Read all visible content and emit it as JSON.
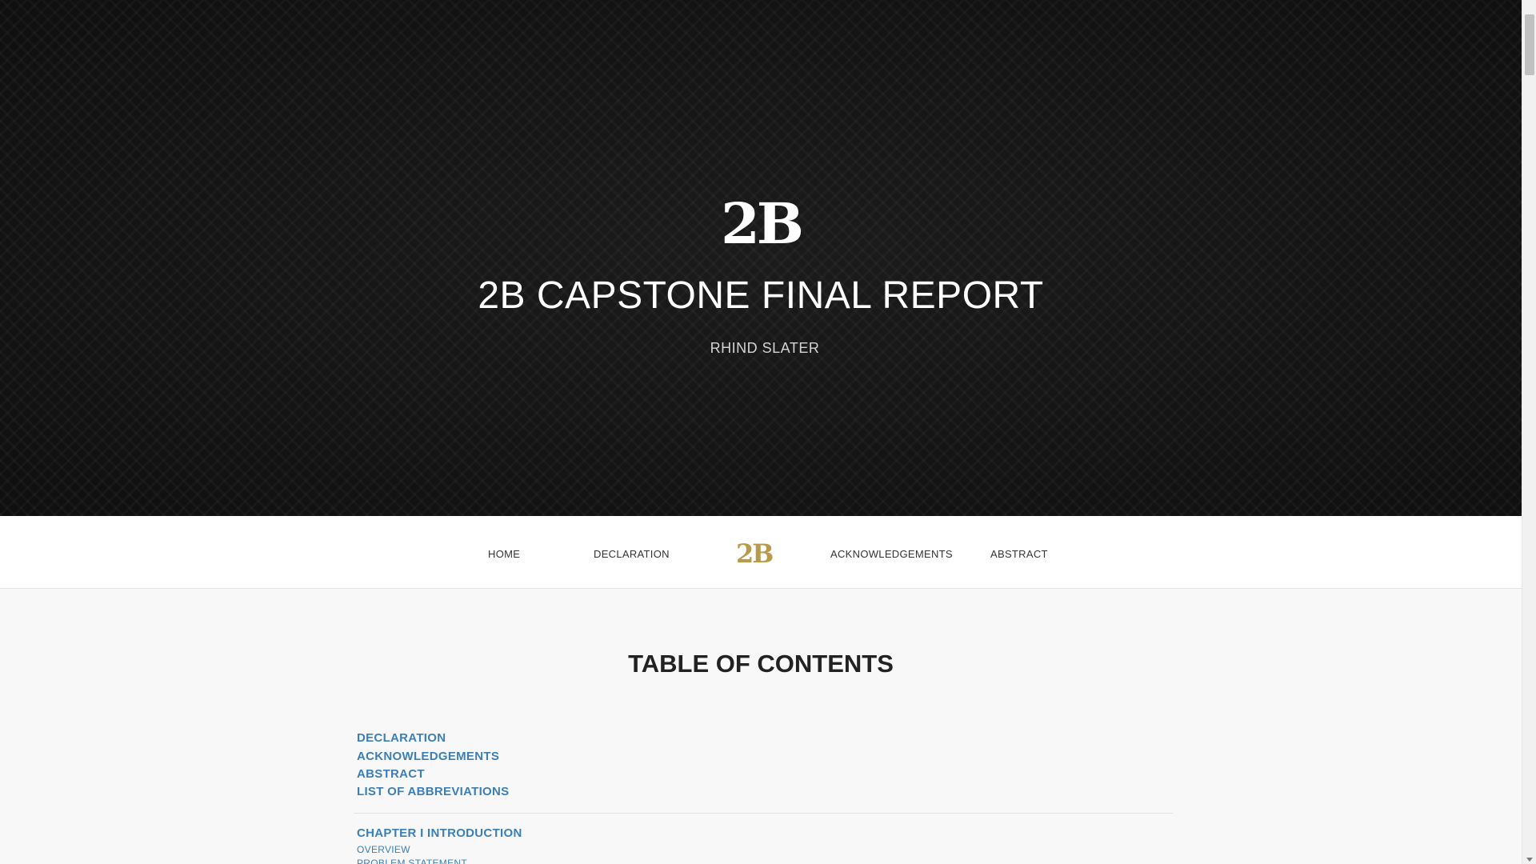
{
  "hero": {
    "logo": "2B",
    "title": "2B CAPSTONE FINAL REPORT",
    "author": "RHIND SLATER"
  },
  "nav": {
    "items": [
      {
        "label": "HOME"
      },
      {
        "label": "DECLARATION"
      },
      {
        "label": "ACKNOWLEDGEMENTS"
      },
      {
        "label": "ABSTRACT"
      }
    ],
    "logo": "2B"
  },
  "toc": {
    "title": "TABLE OF CONTENTS",
    "front_matter": [
      {
        "label": "DECLARATION"
      },
      {
        "label": "ACKNOWLEDGEMENTS"
      },
      {
        "label": "ABSTRACT"
      },
      {
        "label": "LIST OF ABBREVIATIONS"
      }
    ],
    "chapter": {
      "label": "CHAPTER I INTRODUCTION",
      "sections": [
        {
          "label": "OVERVIEW"
        },
        {
          "label": "PROBLEM STATEMENT"
        }
      ]
    }
  },
  "colors": {
    "hero_bg": "#131313",
    "link_blue": "#3b7fb6",
    "logo_gold": "#b89b4a"
  }
}
